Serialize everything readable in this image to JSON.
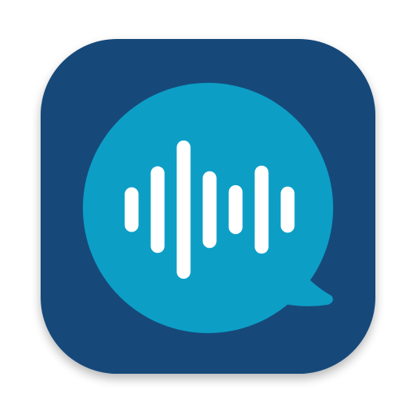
{
  "icon": {
    "name": "voice-chat-app-icon",
    "colors": {
      "tile": "#154a7a",
      "bubble": "#0d9ec6",
      "bars": "#ffffff",
      "shadow": "#000000"
    },
    "waveform_levels": [
      0.32,
      0.62,
      0.99,
      0.55,
      0.35,
      0.63,
      0.33
    ]
  }
}
